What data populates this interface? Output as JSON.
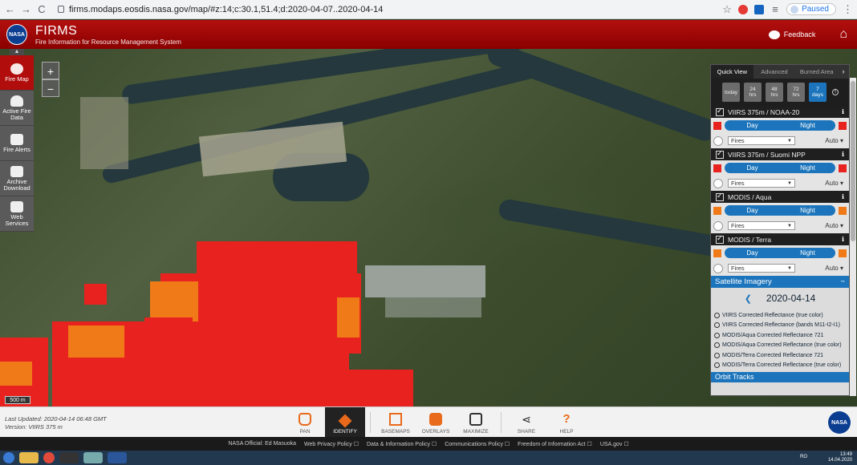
{
  "browser": {
    "url": "firms.modaps.eosdis.nasa.gov/map/#z:14;c:30.1,51.4;d:2020-04-07..2020-04-14",
    "paused_label": "Paused"
  },
  "header": {
    "logo_text": "NASA",
    "title": "FIRMS",
    "subtitle": "Fire Information for Resource Management System",
    "feedback_label": "Feedback"
  },
  "rail": {
    "items": [
      {
        "label": "Fire Map"
      },
      {
        "label": "Active Fire Data"
      },
      {
        "label": "Fire Alerts"
      },
      {
        "label": "Archive Download"
      },
      {
        "label": "Web Services"
      }
    ]
  },
  "map": {
    "zoom_in": "+",
    "zoom_out": "−",
    "scale_label": "500 m"
  },
  "panel": {
    "tabs": [
      "Quick View",
      "Advanced",
      "Burned Area"
    ],
    "ranges": [
      {
        "l1": "today",
        "l2": ""
      },
      {
        "l1": "24",
        "l2": "hrs"
      },
      {
        "l1": "48",
        "l2": "hrs"
      },
      {
        "l1": "72",
        "l2": "hrs"
      },
      {
        "l1": "7",
        "l2": "days"
      }
    ],
    "day_label": "Day",
    "night_label": "Night",
    "fires_label": "Fires",
    "auto_label": "Auto",
    "layers": [
      {
        "name": "VIIRS 375m / NOAA-20",
        "day_color": "#e8231f",
        "night_color": "#e8231f"
      },
      {
        "name": "VIIRS 375m / Suomi NPP",
        "day_color": "#e8231f",
        "night_color": "#e8231f"
      },
      {
        "name": "MODIS / Aqua",
        "day_color": "#f07a18",
        "night_color": "#f07a18"
      },
      {
        "name": "MODIS / Terra",
        "day_color": "#f07a18",
        "night_color": "#f07a18"
      }
    ],
    "imagery_header": "Satellite Imagery",
    "imagery_date": "2020-04-14",
    "imagery_options": [
      "VIIRS Corrected Reflectance (true color)",
      "VIIRS Corrected Reflectance (bands M11-I2-I1)",
      "MODIS/Aqua Corrected Reflectance 721",
      "MODIS/Aqua Corrected Reflectance (true color)",
      "MODIS/Terra Corrected Reflectance 721",
      "MODIS/Terra Corrected Reflectance (true color)"
    ],
    "orbit_label": "Orbit Tracks"
  },
  "bottom": {
    "last_updated": "Last Updated: 2020-04-14 06:48 GMT",
    "version": "Version: VIIRS 375 m",
    "tools": [
      "PAN",
      "IDENTIFY",
      "BASEMAPS",
      "OVERLAYS",
      "MAXIMIZE",
      "SHARE",
      "HELP"
    ]
  },
  "footer": {
    "links": [
      "NASA Official: Ed Masuoka",
      "Web Privacy Policy ☐",
      "Data & Information Policy ☐",
      "Communications Policy ☐",
      "Freedom of Information Act ☐",
      "USA.gov ☐"
    ]
  },
  "taskbar": {
    "lang": "RO",
    "time": "13:49",
    "date": "14.04.2020"
  },
  "colors": {
    "brand_red": "#b3100f",
    "accent_blue": "#1c75bc",
    "fire_red": "#e8231f",
    "fire_orange": "#f07a18"
  }
}
